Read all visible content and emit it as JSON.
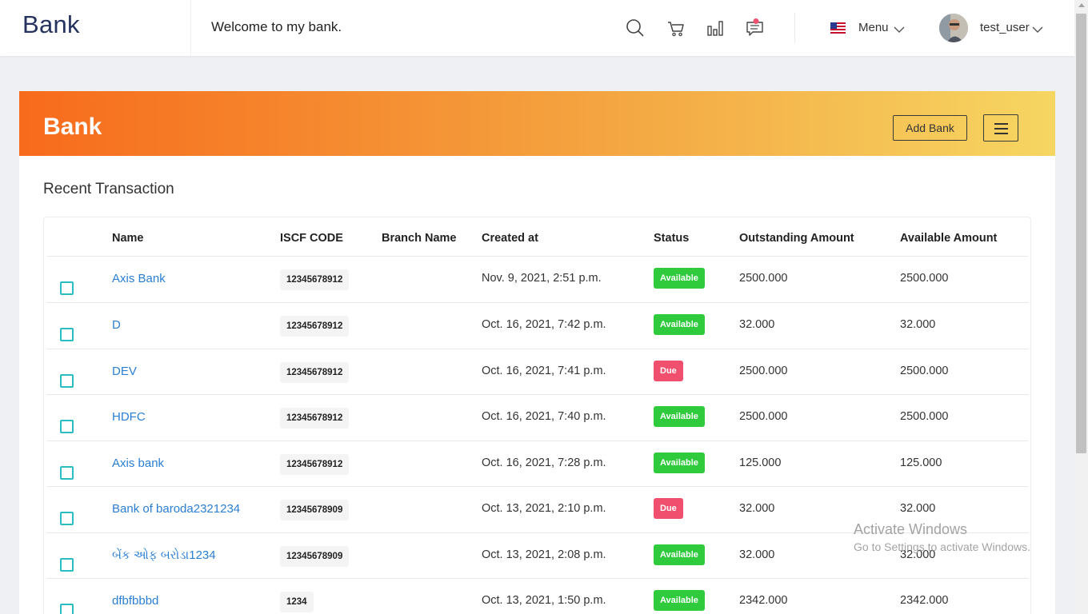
{
  "header": {
    "brand": "Bank",
    "welcome": "Welcome to my bank.",
    "icons": [
      "search-icon",
      "cart-icon",
      "chart-icon",
      "chat-icon"
    ],
    "menu_label": "Menu",
    "user_label": "test_user"
  },
  "card": {
    "title": "Bank",
    "add_button": "Add Bank",
    "section_title": "Recent Transaction",
    "gradient": [
      "#f76b1c",
      "#f6d662"
    ]
  },
  "table": {
    "columns": [
      "Name",
      "ISCF CODE",
      "Branch Name",
      "Created at",
      "Status",
      "Outstanding Amount",
      "Available Amount"
    ],
    "rows": [
      {
        "name": "Axis Bank",
        "code": "12345678912",
        "branch": "",
        "created": "Nov. 9, 2021, 2:51 p.m.",
        "status": "Available",
        "outstanding": "2500.000",
        "available": "2500.000"
      },
      {
        "name": "D",
        "code": "12345678912",
        "branch": "",
        "created": "Oct. 16, 2021, 7:42 p.m.",
        "status": "Available",
        "outstanding": "32.000",
        "available": "32.000"
      },
      {
        "name": "DEV",
        "code": "12345678912",
        "branch": "",
        "created": "Oct. 16, 2021, 7:41 p.m.",
        "status": "Due",
        "outstanding": "2500.000",
        "available": "2500.000"
      },
      {
        "name": "HDFC",
        "code": "12345678912",
        "branch": "",
        "created": "Oct. 16, 2021, 7:40 p.m.",
        "status": "Available",
        "outstanding": "2500.000",
        "available": "2500.000"
      },
      {
        "name": "Axis bank",
        "code": "12345678912",
        "branch": "",
        "created": "Oct. 16, 2021, 7:28 p.m.",
        "status": "Available",
        "outstanding": "125.000",
        "available": "125.000"
      },
      {
        "name": "Bank of baroda2321234",
        "code": "12345678909",
        "branch": "",
        "created": "Oct. 13, 2021, 2:10 p.m.",
        "status": "Due",
        "outstanding": "32.000",
        "available": "32.000"
      },
      {
        "name": "બેંક ઓફ બરોડા1234",
        "code": "12345678909",
        "branch": "",
        "created": "Oct. 13, 2021, 2:08 p.m.",
        "status": "Available",
        "outstanding": "32.000",
        "available": "32.000"
      },
      {
        "name": "dfbfbbbd",
        "code": "1234",
        "branch": "",
        "created": "Oct. 13, 2021, 1:50 p.m.",
        "status": "Available",
        "outstanding": "2342.000",
        "available": "2342.000"
      }
    ]
  },
  "status_colors": {
    "Available": "#2fcb3d",
    "Due": "#f0506e"
  },
  "watermark": {
    "line1": "Activate Windows",
    "line2": "Go to Settings to activate Windows."
  }
}
